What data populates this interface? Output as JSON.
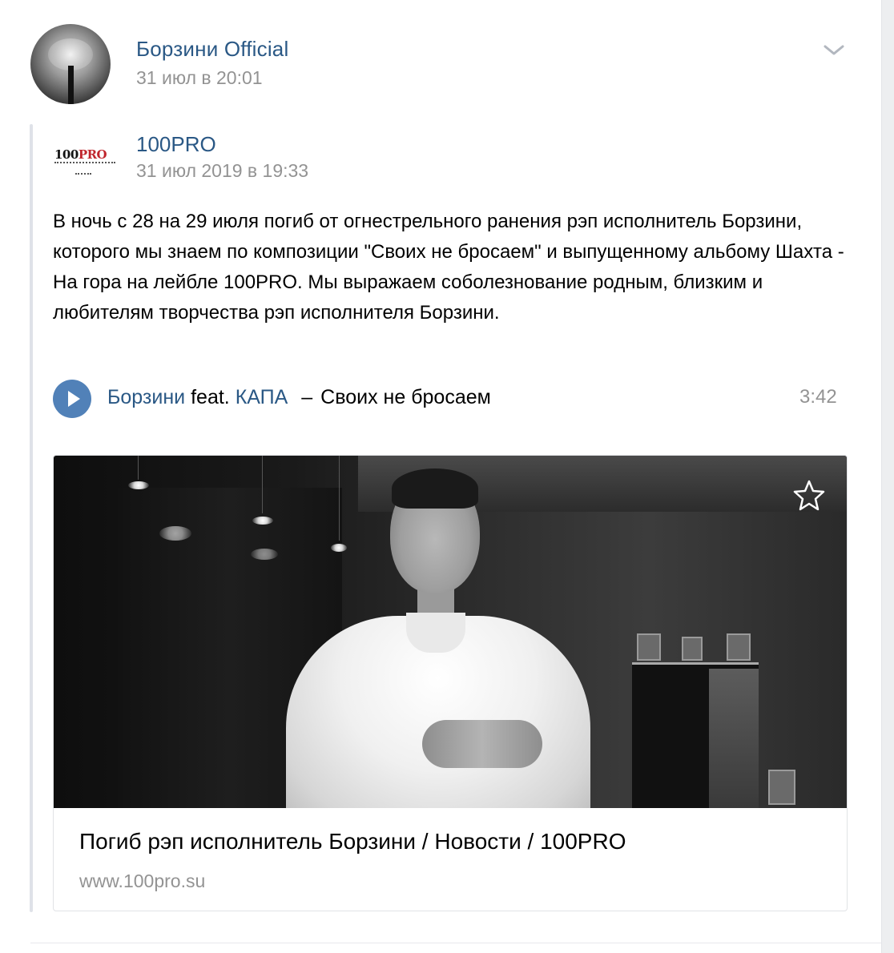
{
  "post": {
    "author": "Борзини Official",
    "date": "31 июл в 20:01"
  },
  "repost": {
    "source_name": "100PRO",
    "source_date": "31 июл 2019 в 19:33",
    "logo_text_main": "100",
    "logo_text_accent": "PRO",
    "text": "В ночь с 28 на 29 июля погиб от огнестрельного ранения рэп исполнитель Борзини, которого мы знаем по композиции \"Своих не бросаем\" и выпущенному альбому Шахта - На гора на лейбле 100PRO. Мы выражаем соболезнование родным, близким и любителям творчества рэп исполнителя Борзини."
  },
  "audio": {
    "artist": "Борзини",
    "feat_word": "feat.",
    "featured_artist": "КАПА",
    "separator": "–",
    "title": "Своих не бросаем",
    "duration": "3:42"
  },
  "link": {
    "title": "Погиб рэп исполнитель Борзини / Новости / 100PRO",
    "domain": "www.100pro.su"
  },
  "icons": {
    "menu": "chevron-down-icon",
    "play": "play-icon",
    "favorite": "star-outline-icon"
  },
  "colors": {
    "link_blue": "#2a5885",
    "accent_blue": "#5181b8",
    "meta_gray": "#939393",
    "logo_red": "#c0262d"
  }
}
